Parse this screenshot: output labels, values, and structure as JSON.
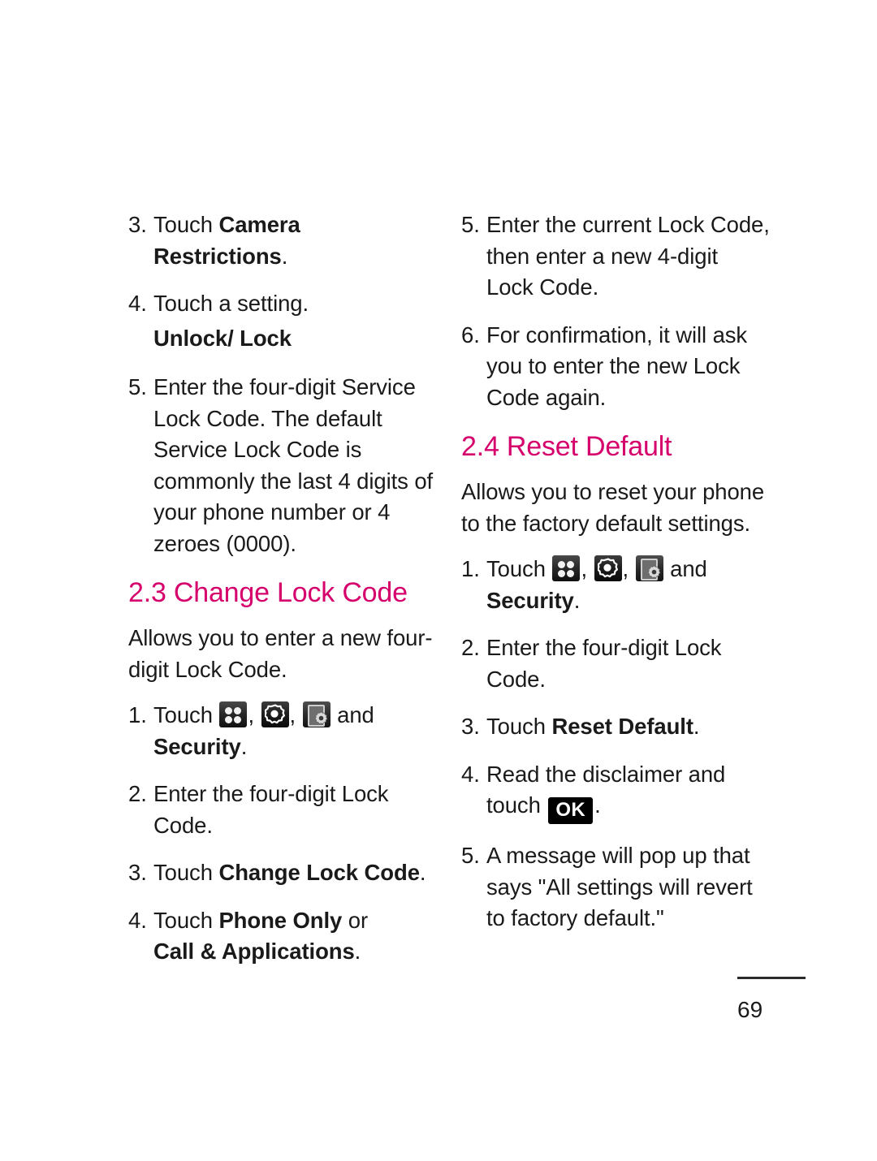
{
  "document": {
    "page_number": "69",
    "accent_color": "#d6006c",
    "icon_names": [
      "apps-grid-icon",
      "settings-gear-icon",
      "phone-settings-icon"
    ],
    "ok_key_label": "OK"
  },
  "left_column": {
    "step3": {
      "num": "3.",
      "pre": "Touch ",
      "bold": "Camera Restrictions",
      "post": "."
    },
    "step4": {
      "num": "4.",
      "text": "Touch a setting."
    },
    "subhead_unlock_lock": "Unlock/ Lock",
    "step5": {
      "num": "5.",
      "text": "Enter the four-digit Service Lock Code. The default Service Lock Code is commonly the last 4 digits of your phone number or 4 zeroes (0000)."
    },
    "heading_2_3": "2.3 Change Lock Code",
    "intro": "Allows you to enter a new four-digit Lock Code.",
    "touch_step": {
      "num": "1.",
      "pre": "Touch ",
      "mid1": ", ",
      "mid2": ", ",
      "post": " and ",
      "bold": "Security",
      "end": "."
    },
    "step2": {
      "num": "2.",
      "text": "Enter the four-digit Lock Code."
    },
    "step3b": {
      "num": "3.",
      "pre": "Touch ",
      "bold": "Change Lock Code",
      "post": "."
    },
    "step4b": {
      "num": "4.",
      "pre": "Touch ",
      "bold1": "Phone Only",
      "mid": " or ",
      "bold2": "Call & Applications",
      "post": "."
    }
  },
  "right_column": {
    "step5": {
      "num": "5.",
      "text": "Enter the current Lock Code, then enter a new 4-digit Lock Code."
    },
    "step6": {
      "num": "6.",
      "text": "For confirmation, it will ask you to enter the new Lock Code again."
    },
    "heading_2_4": "2.4 Reset Default",
    "intro": "Allows you to reset your phone to the factory default settings.",
    "touch_step": {
      "num": "1.",
      "pre": "Touch ",
      "mid1": ", ",
      "mid2": ", ",
      "post": " and ",
      "bold": "Security",
      "end": "."
    },
    "step2": {
      "num": "2.",
      "text": "Enter the four-digit Lock Code."
    },
    "step3": {
      "num": "3.",
      "pre": "Touch ",
      "bold": "Reset Default",
      "post": "."
    },
    "step4": {
      "num": "4.",
      "pre": "Read the disclaimer and touch ",
      "ok": "OK",
      "post": "."
    },
    "step5b": {
      "num": "5.",
      "text": "A message will pop up that says \"All settings will revert to factory default.\""
    }
  }
}
